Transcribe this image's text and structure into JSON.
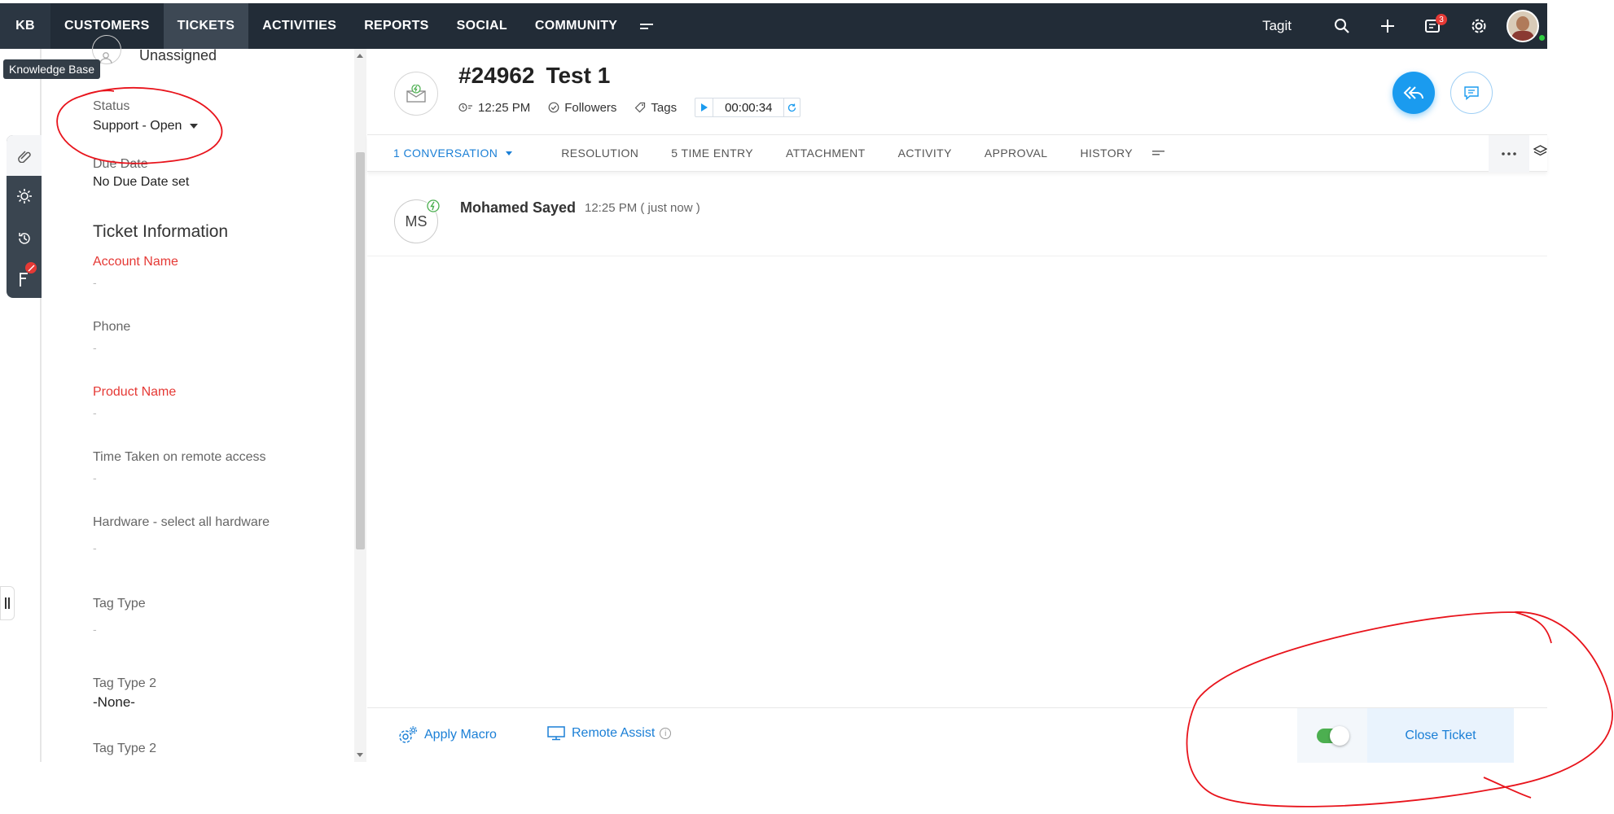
{
  "nav": {
    "kb_label": "KB",
    "items": [
      {
        "label": "CUSTOMERS"
      },
      {
        "label": "TICKETS"
      },
      {
        "label": "ACTIVITIES"
      },
      {
        "label": "REPORTS"
      },
      {
        "label": "SOCIAL"
      },
      {
        "label": "COMMUNITY"
      }
    ],
    "active_item": "TICKETS",
    "brand_text": "Tagit",
    "notification_count": "3",
    "icons": [
      "search-icon",
      "plus-icon",
      "notifications-icon",
      "gear-icon"
    ],
    "colors": {
      "bar": "#222c37",
      "active": "#3d4854",
      "badge": "#e53935"
    }
  },
  "tooltip": {
    "text": "Knowledge Base"
  },
  "rail": {
    "icons": [
      "knowledge-base-icon",
      "lightbulb-icon",
      "history-icon",
      "flag-icon"
    ]
  },
  "left_panel": {
    "assignee": "Unassigned",
    "status": {
      "label": "Status",
      "value": "Support - Open"
    },
    "due_date": {
      "label": "Due Date",
      "value": "No Due Date set"
    },
    "section_title": "Ticket Information",
    "fields": [
      {
        "label": "Account Name",
        "value": "-",
        "required": true
      },
      {
        "label": "Phone",
        "value": "-",
        "required": false
      },
      {
        "label": "Product Name",
        "value": "-",
        "required": true
      },
      {
        "label": "Time Taken on remote access",
        "value": "-",
        "required": false
      },
      {
        "label": "Hardware - select all hardware",
        "value": "-",
        "required": false
      },
      {
        "label": "Tag Type",
        "value": "-",
        "required": false
      },
      {
        "label": "Tag Type 2",
        "value": "-None-",
        "required": false
      },
      {
        "label": "Tag Type 2",
        "value": "",
        "required": false
      }
    ]
  },
  "ticket": {
    "number": "#24962",
    "subject": "Test 1",
    "time": "12:25 PM",
    "followers_label": "Followers",
    "tags_label": "Tags",
    "timer": "00:00:34"
  },
  "tabs": [
    {
      "label": "1 CONVERSATION"
    },
    {
      "label": "RESOLUTION"
    },
    {
      "label": "5 TIME ENTRY"
    },
    {
      "label": "ATTACHMENT"
    },
    {
      "label": "ACTIVITY"
    },
    {
      "label": "APPROVAL"
    },
    {
      "label": "HISTORY"
    }
  ],
  "conversation": {
    "initials": "MS",
    "name": "Mohamed Sayed",
    "time": "12:25 PM ( just now )"
  },
  "footer": {
    "apply_macro": "Apply Macro",
    "remote_assist": "Remote Assist",
    "close_ticket": "Close Ticket",
    "toggle_on": true
  },
  "colors": {
    "accent": "#1a9bef",
    "link": "#1a7fd6",
    "required": "#e53935",
    "annotation": "#e8141c"
  }
}
